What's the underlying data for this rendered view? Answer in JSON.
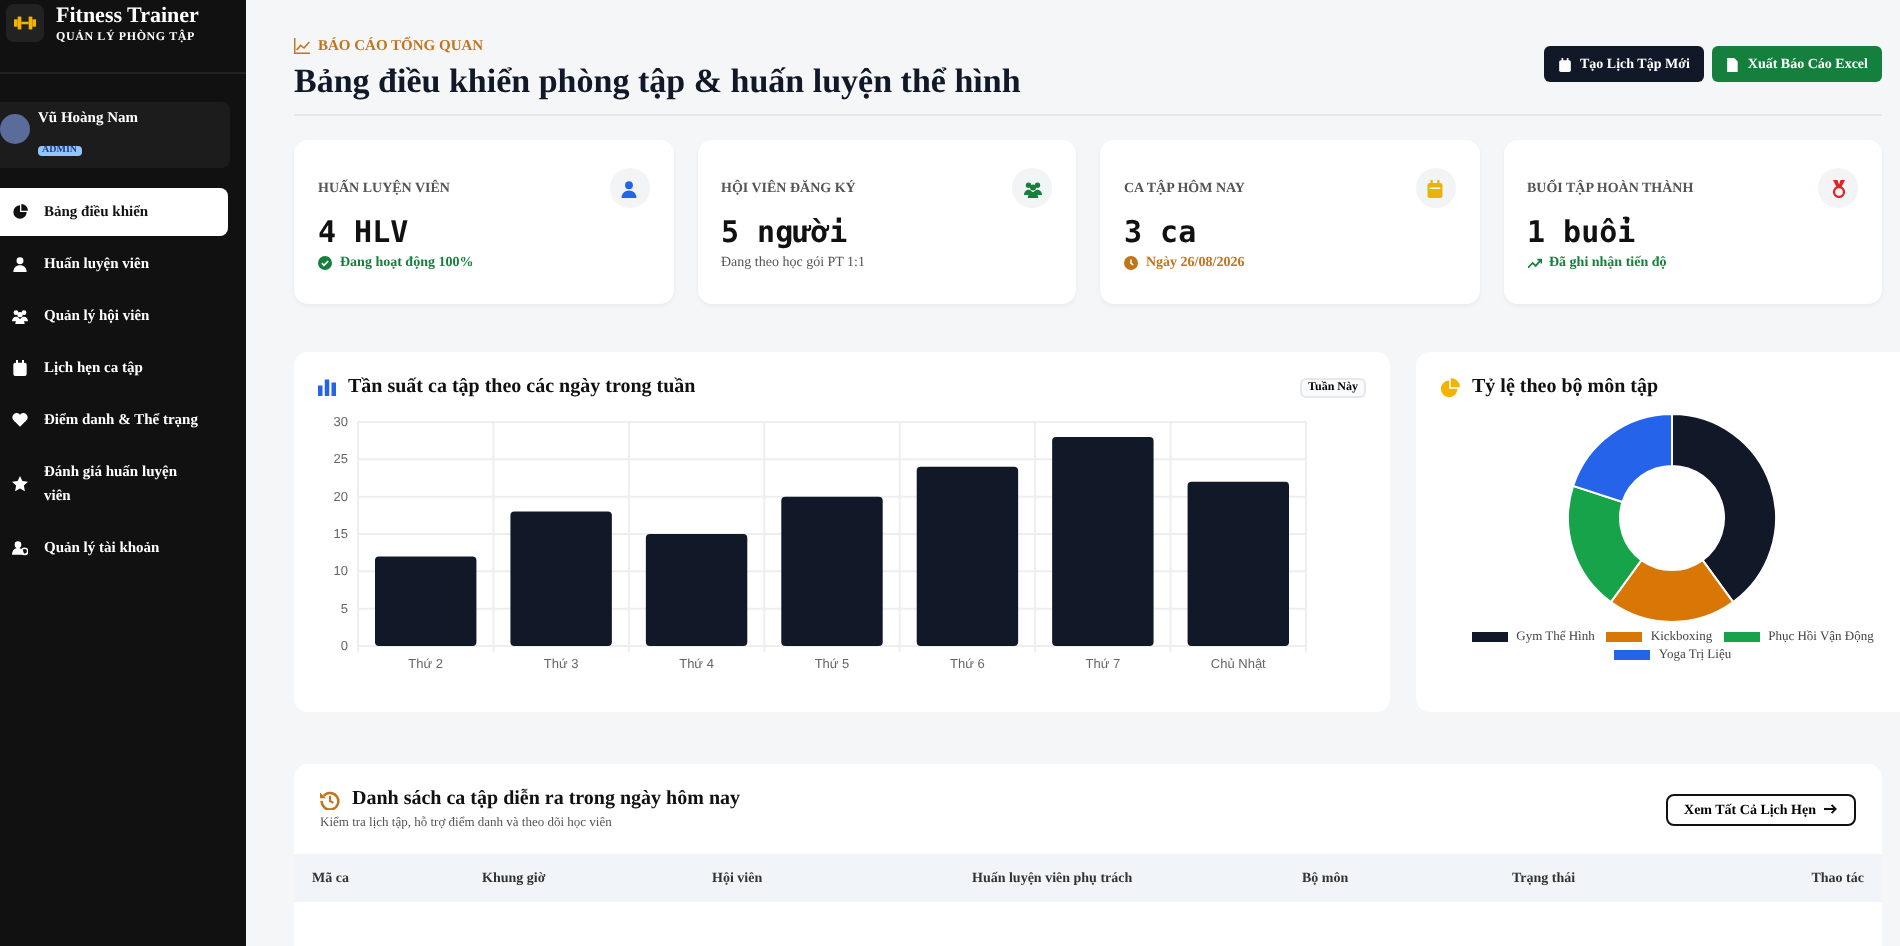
{
  "sidebar": {
    "brand": "Fitness Trainer",
    "tagline": "QUẢN LÝ PHÒNG TẬP",
    "user": {
      "name": "Vũ Hoàng Nam",
      "role": "ADMIN"
    },
    "items": [
      {
        "label": "Bảng điều khiển",
        "kind": "dashboard",
        "selected": true
      },
      {
        "label": "Huấn luyện viên",
        "kind": "trainer",
        "selected": false
      },
      {
        "label": "Quản lý hội viên",
        "kind": "members",
        "selected": false
      },
      {
        "label": "Lịch hẹn ca tập",
        "kind": "calendar",
        "selected": false
      },
      {
        "label": "Điểm danh & Thể trạng",
        "kind": "heart",
        "selected": false
      },
      {
        "label": "Đánh giá huấn luyện viên",
        "kind": "star",
        "selected": false
      },
      {
        "label": "Quản lý tài khoản",
        "kind": "account",
        "selected": false
      }
    ]
  },
  "header": {
    "eyebrow": "BÁO CÁO TỔNG QUAN",
    "title": "Bảng điều khiển phòng tập & huấn luyện thể hình",
    "buttons": [
      {
        "label": "Tạo Lịch Tập Mới",
        "kind": "dark"
      },
      {
        "label": "Xuất Báo Cáo Excel",
        "kind": "green"
      }
    ]
  },
  "stats": [
    {
      "label": "HUẤN LUYỆN VIÊN",
      "value": "4 HLV",
      "note": {
        "text": "Đang hoạt động 100%",
        "kind": "ok"
      },
      "kind": "trainer"
    },
    {
      "label": "HỘI VIÊN ĐĂNG KÝ",
      "value": "5 người",
      "note": {
        "text": "Đang theo học gói PT 1:1",
        "kind": "plain"
      },
      "kind": "members"
    },
    {
      "label": "CA TẬP HÔM NAY",
      "value": "3 ca",
      "note": {
        "text": "Ngày 26/08/2026",
        "kind": "date"
      },
      "kind": "calendar"
    },
    {
      "label": "BUỔI TẬP HOÀN THÀNH",
      "value": "1 buổi",
      "note": {
        "text": "Đã ghi nhận tiến độ",
        "kind": "trend"
      },
      "kind": "medal"
    }
  ],
  "weekly_chart": {
    "title": "Tần suất ca tập theo các ngày trong tuần",
    "filter": "Tuần Này",
    "chart_data": {
      "type": "bar",
      "categories": [
        "Thứ 2",
        "Thứ 3",
        "Thứ 4",
        "Thứ 5",
        "Thứ 6",
        "Thứ 7",
        "Chủ Nhật"
      ],
      "values": [
        12,
        18,
        15,
        20,
        24,
        28,
        22
      ],
      "ylim": [
        0,
        30
      ],
      "yticks": [
        0,
        5,
        10,
        15,
        20,
        25,
        30
      ],
      "grid": true
    }
  },
  "category_chart": {
    "title": "Tỷ lệ theo bộ môn tập",
    "chart_data": {
      "type": "donut",
      "categories": [
        "Gym Thể Hình",
        "Kickboxing",
        "Phục Hồi Vận Động",
        "Yoga Trị Liệu"
      ],
      "values": [
        40,
        20,
        20,
        20
      ],
      "colors": [
        "#111827",
        "#d97706",
        "#16a34a",
        "#2563eb"
      ]
    }
  },
  "sessions": {
    "title": "Danh sách ca tập diễn ra trong ngày hôm nay",
    "subtitle": "Kiểm tra lịch tập, hỗ trợ điểm danh và theo dõi học viên",
    "link": "Xem Tất Cả Lịch Hẹn",
    "columns": [
      "Mã ca",
      "Khung giờ",
      "Hội viên",
      "Huấn luyện viên phụ trách",
      "Bộ môn",
      "Trạng thái",
      "Thao tác"
    ]
  }
}
